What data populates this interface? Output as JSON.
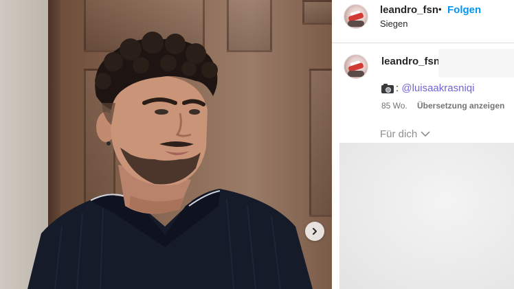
{
  "post": {
    "username": "leandro_fsn",
    "separator": "•",
    "follow_label": "Folgen",
    "location": "Siegen"
  },
  "comment": {
    "username": "leandro_fsn",
    "mention_prefix": ":",
    "mention": "@luisaakrasniqi",
    "age": "85 Wo.",
    "translate_label": "Übersetzung anzeigen"
  },
  "feed": {
    "for_you_label": "Für dich"
  },
  "icons": {
    "camera": "camera-emoji-icon",
    "next": "chevron-right-icon",
    "dropdown": "chevron-down-icon"
  },
  "colors": {
    "follow": "#0095f6",
    "mention": "#6f65d8",
    "muted": "#737373"
  }
}
